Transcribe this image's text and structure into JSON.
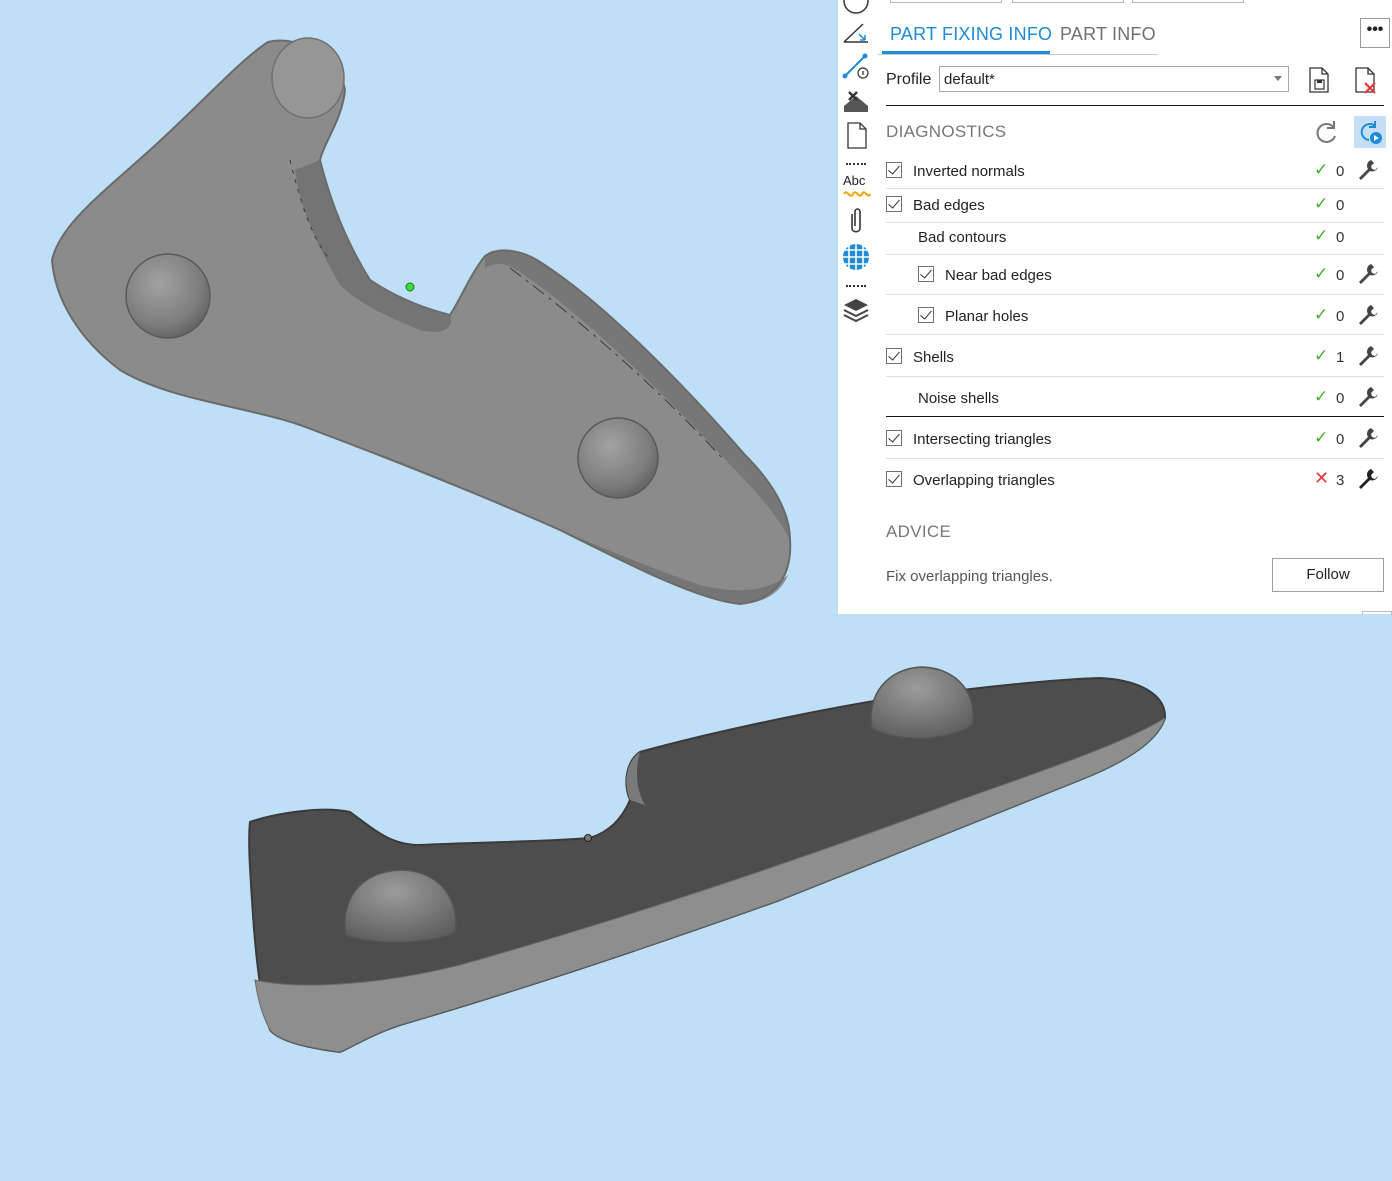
{
  "tabs": [
    {
      "label": "PART FIXING INFO",
      "active": true
    },
    {
      "label": "PART INFO",
      "active": false
    }
  ],
  "more_button": "•••",
  "profile": {
    "label": "Profile",
    "value": "default*"
  },
  "diagnostics": {
    "title": "DIAGNOSTICS",
    "rows": [
      {
        "label": "Inverted normals",
        "checked": true,
        "status": "ok",
        "count": "0",
        "fixable": true
      },
      {
        "label": "Bad edges",
        "checked": true,
        "status": "ok",
        "count": "0",
        "fixable": false
      },
      {
        "label": "Bad contours",
        "checked": null,
        "status": "ok",
        "count": "0",
        "fixable": false
      },
      {
        "label": "Near bad edges",
        "checked": true,
        "status": "ok",
        "count": "0",
        "fixable": true
      },
      {
        "label": "Planar holes",
        "checked": true,
        "status": "ok",
        "count": "0",
        "fixable": true
      },
      {
        "label": "Shells",
        "checked": true,
        "status": "ok",
        "count": "1",
        "fixable": true
      },
      {
        "label": "Noise shells",
        "checked": null,
        "status": "ok",
        "count": "0",
        "fixable": true
      },
      {
        "label": "Intersecting triangles",
        "checked": true,
        "status": "ok",
        "count": "0",
        "fixable": true
      },
      {
        "label": "Overlapping triangles",
        "checked": true,
        "status": "bad",
        "count": "3",
        "fixable": true
      }
    ]
  },
  "advice": {
    "title": "ADVICE",
    "text": "Fix overlapping triangles.",
    "button": "Follow"
  },
  "glyphs": {
    "ok": "✓",
    "bad": "✕"
  },
  "toolbar_text": {
    "abc": "Abc"
  },
  "colors": {
    "viewport_bg": "#bfdff7",
    "accent": "#1f8ad6",
    "ok": "#43b02a",
    "error": "#e53935",
    "mesh_light": "#8a8a8a",
    "mesh_dark": "#4a4a4a"
  }
}
